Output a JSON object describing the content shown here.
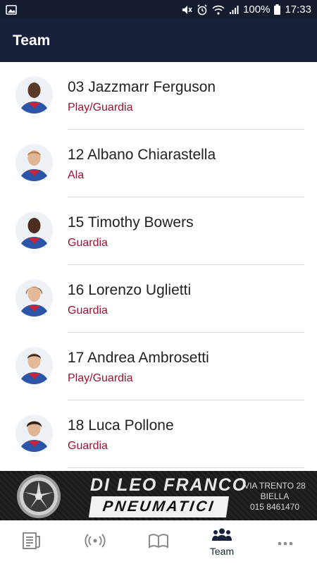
{
  "status_bar": {
    "battery": "100%",
    "time": "17:33"
  },
  "app_bar": {
    "title": "Team"
  },
  "players": [
    {
      "name": "03 Jazzmarr Ferguson",
      "role": "Play/Guardia"
    },
    {
      "name": "12 Albano Chiarastella",
      "role": "Ala"
    },
    {
      "name": "15 Timothy Bowers",
      "role": "Guardia"
    },
    {
      "name": "16 Lorenzo Uglietti",
      "role": "Guardia"
    },
    {
      "name": "17 Andrea Ambrosetti",
      "role": "Play/Guardia"
    },
    {
      "name": "18 Luca Pollone",
      "role": "Guardia"
    }
  ],
  "ad": {
    "brand": "DI LEO FRANCO",
    "product": "PNEUMATICI",
    "address": "VIA TRENTO 28",
    "city": "BIELLA",
    "phone": "015 8461470"
  },
  "bottom_nav": {
    "items": [
      {
        "icon": "news-icon",
        "label": ""
      },
      {
        "icon": "live-broadcast-icon",
        "label": ""
      },
      {
        "icon": "open-book-icon",
        "label": ""
      },
      {
        "icon": "team-icon",
        "label": "Team"
      },
      {
        "icon": "more-icon",
        "label": ""
      }
    ]
  },
  "colors": {
    "app_bar": "#18213a",
    "status_bar": "#141d30",
    "role_text": "#9b1532"
  }
}
